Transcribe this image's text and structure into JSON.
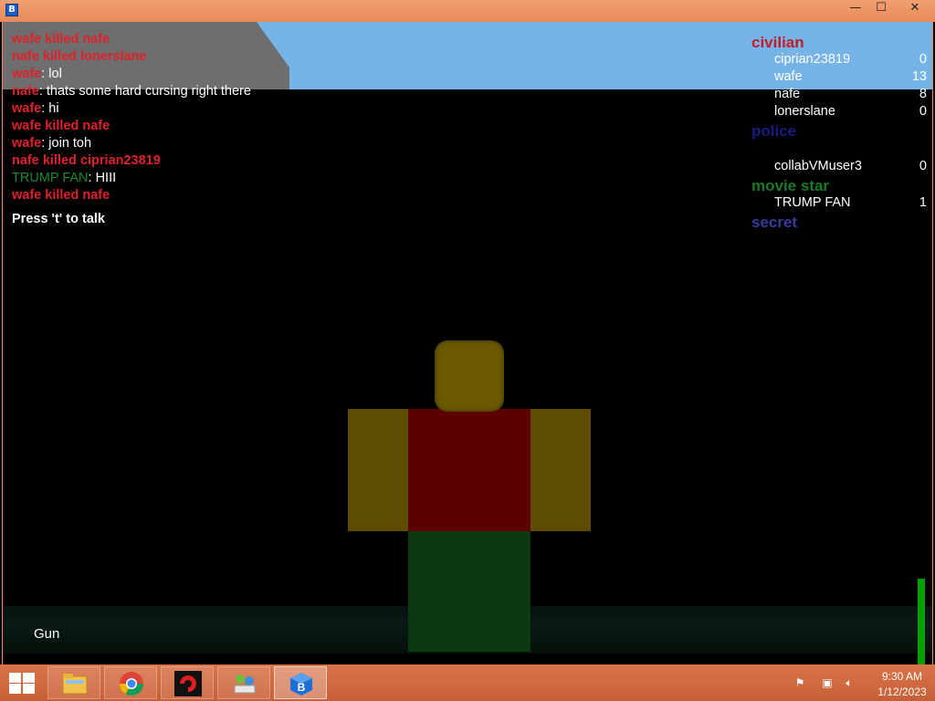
{
  "window": {
    "app_icon_glyph": "B",
    "controls": {
      "minimize": "—",
      "maximize": "☐",
      "close": "✕"
    }
  },
  "chat": [
    {
      "type": "kill",
      "text": "wafe killed nafe"
    },
    {
      "type": "kill",
      "text": "nafe killed lonerslane"
    },
    {
      "type": "msg",
      "who": "wafe",
      "msg": ": lol"
    },
    {
      "type": "msg",
      "who": "nafe",
      "msg": ": thats some hard cursing right there"
    },
    {
      "type": "msg",
      "who": "wafe",
      "msg": ": hi"
    },
    {
      "type": "kill",
      "text": "wafe killed nafe"
    },
    {
      "type": "msg",
      "who": "wafe",
      "msg": ": join toh"
    },
    {
      "type": "kill",
      "text": "nafe killed ciprian23819"
    },
    {
      "type": "trump",
      "who": "TRUMP FAN",
      "msg": ": HIII"
    },
    {
      "type": "kill",
      "text": "wafe killed nafe"
    }
  ],
  "chat_hint": "Press 't' to talk",
  "leaderboard": {
    "civilian": {
      "name": "civilian",
      "players": [
        {
          "name": "ciprian23819",
          "score": "0"
        },
        {
          "name": "wafe",
          "score": "13"
        },
        {
          "name": "nafe",
          "score": "8"
        },
        {
          "name": "lonerslane",
          "score": "0"
        }
      ]
    },
    "police": {
      "name": "police",
      "players": [
        {
          "name": "collabVMuser3",
          "score": "0"
        }
      ]
    },
    "movie_star": {
      "name": "movie star",
      "players": [
        {
          "name": "TRUMP FAN",
          "score": "1"
        }
      ]
    },
    "secret": {
      "name": "secret"
    }
  },
  "tool": "Gun",
  "health_fraction": 1.0,
  "colors": {
    "sky": "#76b4e8",
    "kill_text": "#e0202a",
    "health": "#00a000",
    "taskbar": "#d26a40"
  },
  "taskbar": {
    "items": [
      "windows-start-icon",
      "file-explorer-icon",
      "chrome-icon",
      "garena-icon",
      "network-icon",
      "roblox-icon"
    ],
    "clock_time": "9:30 AM",
    "clock_date": "1/12/2023"
  }
}
